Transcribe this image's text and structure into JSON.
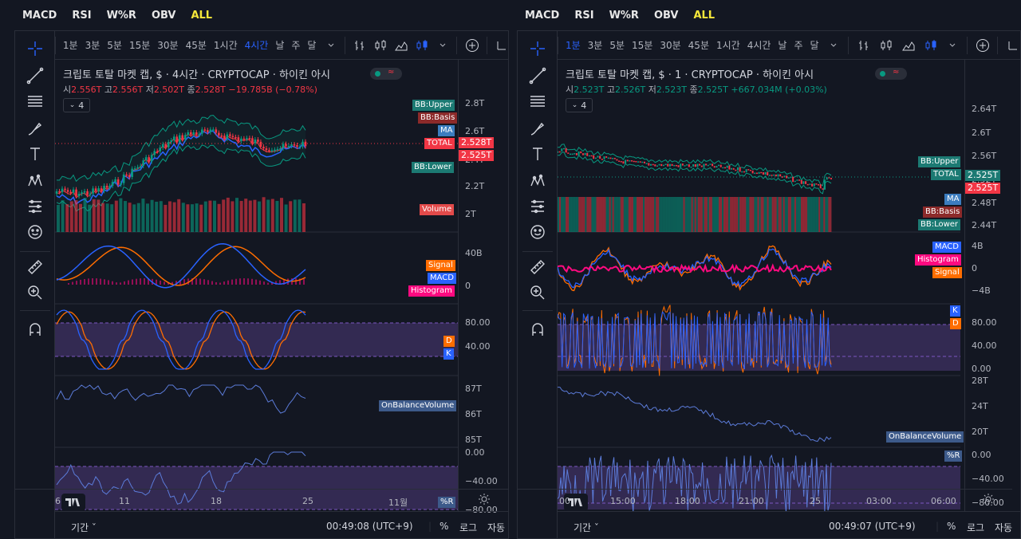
{
  "top_tabs": {
    "left": [
      "MACD",
      "RSI",
      "W%R",
      "OBV",
      "ALL"
    ],
    "right": [
      "MACD",
      "RSI",
      "W%R",
      "OBV",
      "ALL"
    ],
    "active": "ALL"
  },
  "timeframes": [
    "1분",
    "3분",
    "5분",
    "15분",
    "30분",
    "45분",
    "1시간",
    "4시간",
    "날",
    "주",
    "달"
  ],
  "colors": {
    "up": "#089981",
    "down": "#f23645",
    "macd": "#2962ff",
    "signal": "#ff6d00",
    "histogram": "#ff0a80",
    "obv": "#5b7bd8",
    "stoch_d": "#ff6d00",
    "stoch_k": "#2962ff",
    "wr": "#7e57c2",
    "active_tab": "#f5e73a"
  },
  "left": {
    "title": "크립토 토탈 마켓 캡, $ · 4시간 · CRYPTOCAP · 하이킨 아시",
    "ohlc": {
      "o_label": "시",
      "o": "2.556T",
      "h_label": "고",
      "h": "2.556T",
      "l_label": "저",
      "l": "2.502T",
      "c_label": "종",
      "c": "2.528T",
      "chg": "−19.785B (−0.78%)"
    },
    "indicator_count": "4",
    "legend_tags": {
      "bb_upper": "BB:Upper",
      "bb_basis": "BB:Basis",
      "ma": "MA",
      "total": "TOTAL",
      "bb_lower": "BB:Lower",
      "volume": "Volume",
      "signal": "Signal",
      "macd": "MACD",
      "histogram": "Histogram",
      "d": "D",
      "k": "K",
      "obv": "OnBalanceVolume",
      "wr": "%R"
    },
    "price_labels": {
      "total": "2.528T",
      "last": "2.525T"
    },
    "axis": {
      "price": [
        "2.8T",
        "2.6T",
        "2.4T",
        "2.2T",
        "2T"
      ],
      "macd": [
        "40B",
        "0"
      ],
      "stoch": [
        "80.00",
        "40.00"
      ],
      "obv": [
        "87T",
        "86T",
        "85T"
      ],
      "wr": [
        "0.00",
        "−40.00",
        "−80.00"
      ]
    },
    "time_labels": [
      "6",
      "11",
      "18",
      "25",
      "11월"
    ],
    "bottom": {
      "range": "기간",
      "clock": "00:49:08 (UTC+9)",
      "pct": "%",
      "log": "로그",
      "auto": "자동"
    }
  },
  "right": {
    "title": "크립토 토탈 마켓 캡, $ · 1 · CRYPTOCAP · 하이킨 아시",
    "ohlc": {
      "o_label": "시",
      "o": "2.523T",
      "h_label": "고",
      "h": "2.526T",
      "l_label": "저",
      "l": "2.523T",
      "c_label": "종",
      "c": "2.525T",
      "chg": "+667.034M (+0.03%)"
    },
    "indicator_count": "4",
    "legend_tags": {
      "bb_upper": "BB:Upper",
      "total": "TOTAL",
      "ma": "MA",
      "bb_basis": "BB:Basis",
      "bb_lower": "BB:Lower",
      "macd": "MACD",
      "histogram": "Histogram",
      "signal": "Signal",
      "k": "K",
      "d": "D",
      "obv": "OnBalanceVolume",
      "wr": "%R"
    },
    "price_labels": {
      "total": "2.525T",
      "last": "2.525T"
    },
    "axis": {
      "price": [
        "2.64T",
        "2.6T",
        "2.56T",
        "2.52T",
        "2.48T",
        "2.44T"
      ],
      "macd": [
        "4B",
        "0",
        "−4B"
      ],
      "stoch": [
        "80.00",
        "40.00",
        "0.00"
      ],
      "obv": [
        "28T",
        "24T",
        "20T"
      ],
      "wr": [
        "0.00",
        "−40.00",
        "−80.00"
      ]
    },
    "time_labels": [
      "00",
      "15:00",
      "18:00",
      "21:00",
      "25",
      "03:00",
      "06:00"
    ],
    "bottom": {
      "range": "기간",
      "clock": "00:49:07 (UTC+9)",
      "pct": "%",
      "log": "로그",
      "auto": "자동"
    }
  }
}
